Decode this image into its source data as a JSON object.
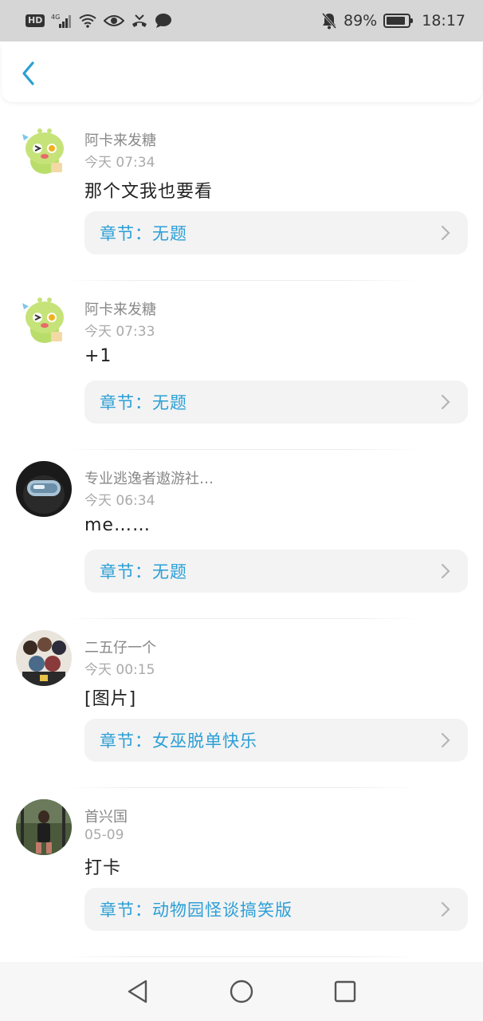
{
  "status_bar": {
    "hd_badge": "HD",
    "network": "4G",
    "battery_percent_label": "89%",
    "battery_level": 0.89,
    "time": "18:17",
    "icons": [
      "hd-icon",
      "signal-icon",
      "wifi-icon",
      "eye-icon",
      "missed-call-icon",
      "message-icon",
      "mute-bell-icon",
      "battery-icon"
    ]
  },
  "header": {
    "back_icon": "chevron-left-icon",
    "accent_color": "#2b9fd6"
  },
  "comments": [
    {
      "username": "阿卡来发糖",
      "time": "今天 07:34",
      "content": "那个文我也要看",
      "chapter": "章节：无题",
      "avatar": "green-dino-avatar"
    },
    {
      "username": "阿卡来发糖",
      "time": "今天 07:33",
      "content": "+1",
      "chapter": "章节：无题",
      "avatar": "green-dino-avatar"
    },
    {
      "username": "专业逃逸者遨游社…",
      "time": "今天 06:34",
      "content": "me……",
      "chapter": "章节：无题",
      "avatar": "crewmate-avatar"
    },
    {
      "username": "二五仔一个",
      "time": "今天 00:15",
      "content": "[图片]",
      "chapter": "章节：女巫脱单快乐",
      "avatar": "anime-group-avatar"
    },
    {
      "username": "首兴国",
      "time": "05-09",
      "content": "打卡",
      "chapter": "章节：动物园怪谈搞笑版",
      "avatar": "photo-avatar"
    }
  ],
  "nav_bar": {
    "back": "triangle-back-icon",
    "home": "circle-home-icon",
    "recents": "square-recents-icon"
  }
}
